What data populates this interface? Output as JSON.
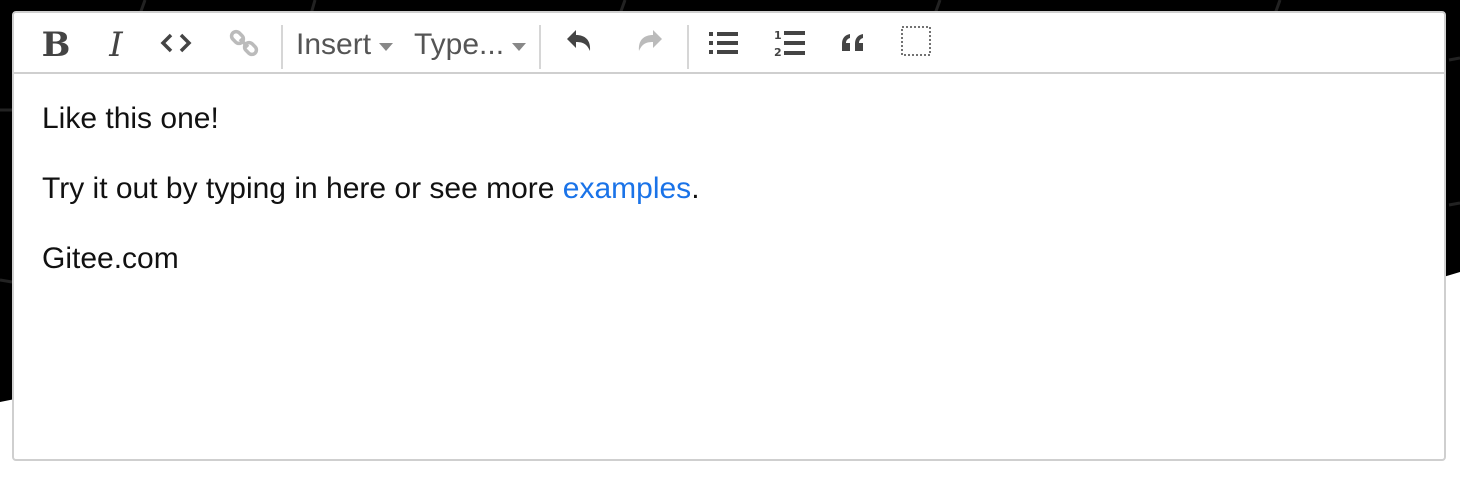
{
  "toolbar": {
    "bold_icon": "bold-icon",
    "italic_icon": "italic-icon",
    "code_icon": "code-icon",
    "link_icon": "link-icon",
    "insert_label": "Insert",
    "type_label": "Type...",
    "undo_icon": "undo-icon",
    "redo_icon": "redo-icon",
    "bullet_list_icon": "bullet-list-icon",
    "ordered_list_icon": "ordered-list-icon",
    "blockquote_icon": "blockquote-icon",
    "select_parent_icon": "select-parent-icon"
  },
  "content": {
    "line1": "Like this one!",
    "line2_before": "Try it out by typing in here or see more ",
    "line2_link": "examples",
    "line2_after": ".",
    "line3": "Gitee.com"
  },
  "colors": {
    "link": "#1a73e8",
    "border": "#cfcfcf",
    "backdrop": "#000000"
  }
}
